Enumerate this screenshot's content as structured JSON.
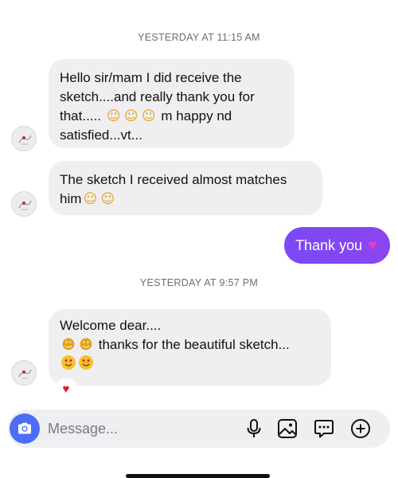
{
  "timestamps": {
    "first": "YESTERDAY AT 11:15 AM",
    "second": "YESTERDAY AT 9:57 PM"
  },
  "messages": [
    {
      "direction": "received",
      "lines": [
        "Hello sir/mam I did receive the",
        "sketch....and really  thank you  for",
        "that..... ",
        "satisfied...vt..."
      ],
      "inline_text": " m happy nd"
    },
    {
      "direction": "received",
      "lines": [
        "The sketch I received almost matches",
        "him"
      ]
    },
    {
      "direction": "sent",
      "text": "Thank you",
      "color": "#7c4dff"
    },
    {
      "direction": "received",
      "lines": [
        "Welcome dear....",
        " thanks for the beautiful  sketch..."
      ],
      "reaction": "heart"
    }
  ],
  "icons": {
    "blush": "smiling-face-icon",
    "heart_eyes": "heart-eyes-icon",
    "purple_heart": "purple-heart-icon",
    "red_heart": "red-heart-icon",
    "camera": "camera-icon",
    "mic": "microphone-icon",
    "gallery": "gallery-icon",
    "sticker": "sticker-icon",
    "plus": "plus-icon"
  },
  "composer": {
    "placeholder": "Message..."
  },
  "colors": {
    "sent_bubble": "#7c4dff",
    "received_bubble": "#efeff2",
    "camera_button": "#4c6ef5",
    "reaction_heart": "#e0152b"
  }
}
